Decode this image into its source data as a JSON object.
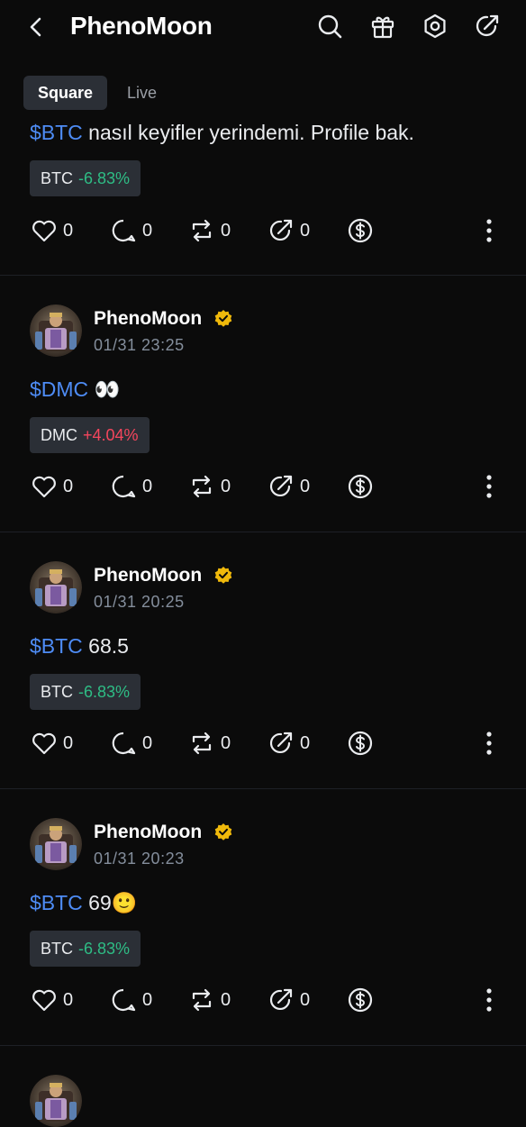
{
  "header": {
    "title": "PhenoMoon",
    "icons": [
      "back-icon",
      "search-icon",
      "gift-icon",
      "settings-icon",
      "share-icon"
    ]
  },
  "tabs": [
    {
      "label": "Square",
      "active": true
    },
    {
      "label": "Live",
      "active": false
    }
  ],
  "colors": {
    "accent_link": "#4e8cf5",
    "negative_change": "#2ebd85",
    "positive_change": "#f6465d",
    "verified": "#f0b90b"
  },
  "first_post": {
    "tag": "$BTC",
    "text": " nasıl keyifler yerindemi. Profile bak.",
    "chip": {
      "symbol": "BTC",
      "change": "-6.83%"
    },
    "counts": {
      "like": "0",
      "comment": "0",
      "repost": "0",
      "share": "0"
    }
  },
  "posts": [
    {
      "author": "PhenoMoon",
      "time": "01/31 23:25",
      "tag": "$DMC",
      "text": " 👀",
      "chip": {
        "symbol": "DMC",
        "change": "+4.04%"
      },
      "counts": {
        "like": "0",
        "comment": "0",
        "repost": "0",
        "share": "0"
      }
    },
    {
      "author": "PhenoMoon",
      "time": "01/31 20:25",
      "tag": "$BTC",
      "text": " 68.5",
      "chip": {
        "symbol": "BTC",
        "change": "-6.83%"
      },
      "counts": {
        "like": "0",
        "comment": "0",
        "repost": "0",
        "share": "0"
      }
    },
    {
      "author": "PhenoMoon",
      "time": "01/31 20:23",
      "tag": "$BTC",
      "text": " 69🙂",
      "chip": {
        "symbol": "BTC",
        "change": "-6.83%"
      },
      "counts": {
        "like": "0",
        "comment": "0",
        "repost": "0",
        "share": "0"
      }
    }
  ]
}
